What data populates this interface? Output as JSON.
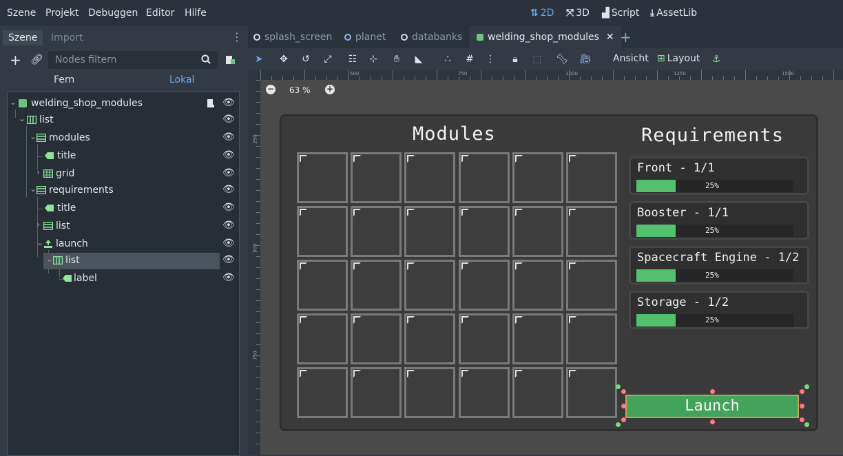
{
  "menu": {
    "items": [
      "Szene",
      "Projekt",
      "Debuggen",
      "Editor",
      "Hilfe"
    ]
  },
  "modes": [
    {
      "label": "2D",
      "active": true,
      "icon": "2d-icon"
    },
    {
      "label": "3D",
      "active": false,
      "icon": "3d-icon"
    },
    {
      "label": "Script",
      "active": false,
      "icon": "script-icon"
    },
    {
      "label": "AssetLib",
      "active": false,
      "icon": "assetlib-icon"
    }
  ],
  "dock": {
    "tabs": [
      "Szene",
      "Import"
    ],
    "filter_placeholder": "Nodes filtern",
    "scope": {
      "remote": "Fern",
      "local": "Lokal"
    }
  },
  "tree": [
    {
      "label": "welding_shop_modules",
      "depth": 0,
      "icon": "control-icon",
      "expanded": true,
      "script": true
    },
    {
      "label": "list",
      "depth": 1,
      "icon": "hbox-icon",
      "expanded": true
    },
    {
      "label": "modules",
      "depth": 2,
      "icon": "vbox-icon",
      "expanded": true
    },
    {
      "label": "title",
      "depth": 3,
      "icon": "label-icon"
    },
    {
      "label": "grid",
      "depth": 3,
      "icon": "grid-container-icon",
      "expanded": false
    },
    {
      "label": "requirements",
      "depth": 2,
      "icon": "vbox-icon",
      "expanded": true
    },
    {
      "label": "title",
      "depth": 3,
      "icon": "label-icon"
    },
    {
      "label": "list",
      "depth": 3,
      "icon": "vbox-icon",
      "expanded": false
    },
    {
      "label": "launch",
      "depth": 3,
      "icon": "button-icon",
      "expanded": true
    },
    {
      "label": "list",
      "depth": 4,
      "icon": "hbox-icon",
      "expanded": true,
      "selected": true
    },
    {
      "label": "label",
      "depth": 5,
      "icon": "label-icon"
    }
  ],
  "editor_tabs": [
    {
      "label": "splash_screen",
      "active": false
    },
    {
      "label": "planet",
      "active": false
    },
    {
      "label": "databanks",
      "active": false
    },
    {
      "label": "welding_shop_modules",
      "active": true
    }
  ],
  "toolbar": {
    "view_label": "Ansicht",
    "layout_label": "Layout"
  },
  "ruler": {
    "labels": [
      "500",
      "750",
      "1000",
      "1250",
      "1500"
    ],
    "left_labels": [
      "250",
      "500",
      "750"
    ]
  },
  "zoom": {
    "label": "63 %"
  },
  "game": {
    "modules_title": "Modules",
    "requirements_title": "Requirements",
    "grid": {
      "rows": 5,
      "cols": 6
    },
    "requirements": [
      {
        "label": "Front - 1/1",
        "progress_pct": 25,
        "text": "25%"
      },
      {
        "label": "Booster - 1/1",
        "progress_pct": 25,
        "text": "25%"
      },
      {
        "label": "Spacecraft Engine - 1/2",
        "progress_pct": 25,
        "text": "25%"
      },
      {
        "label": "Storage - 1/2",
        "progress_pct": 25,
        "text": "25%"
      }
    ],
    "launch_label": "Launch"
  },
  "colors": {
    "accent": "#6aa7f2",
    "progress": "#53c06e",
    "launch": "#43a35a"
  }
}
